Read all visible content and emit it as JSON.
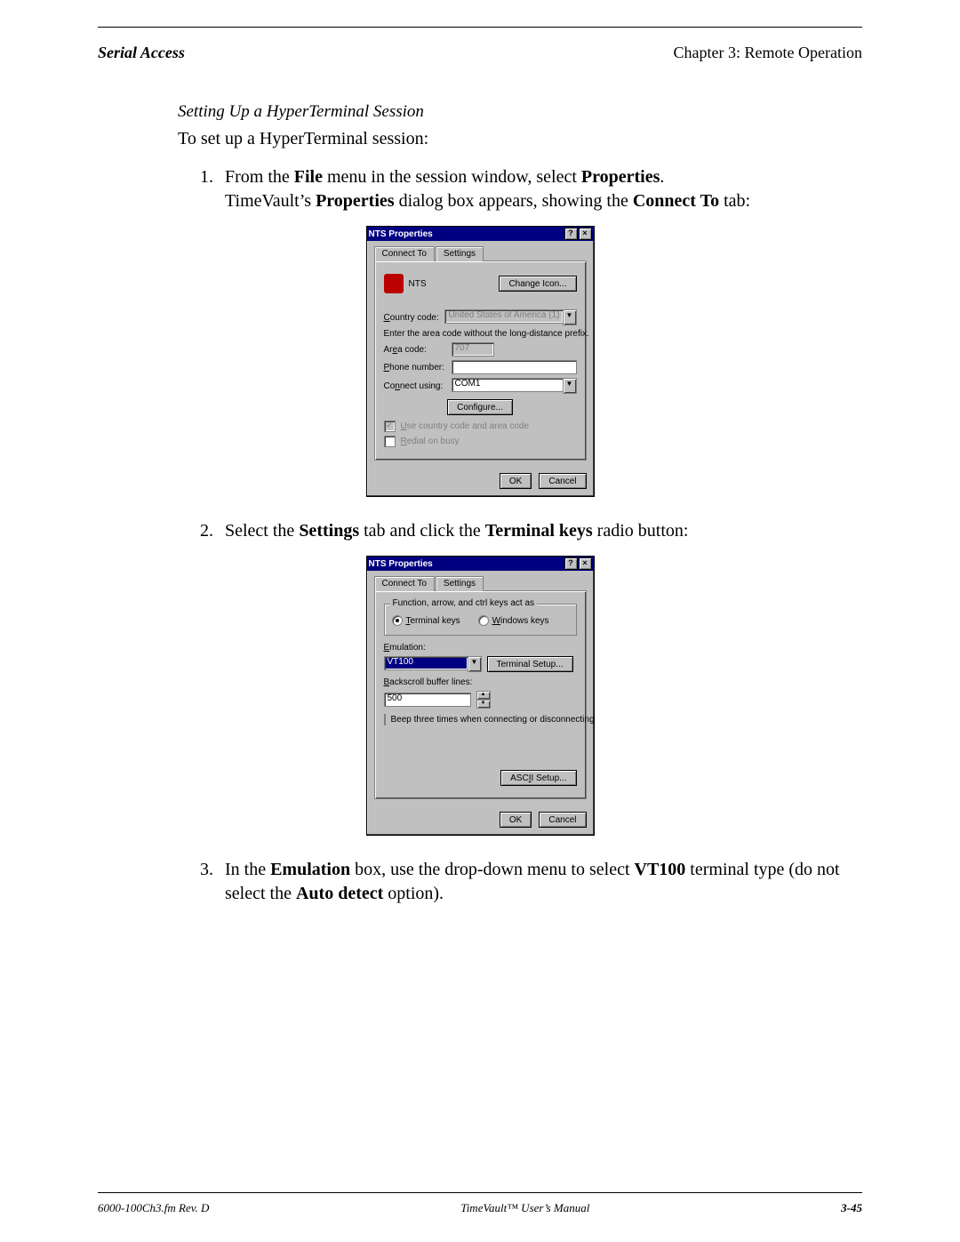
{
  "header": {
    "left": "Serial Access",
    "right": "Chapter 3: Remote Operation"
  },
  "section_title": "Setting Up a HyperTerminal Session",
  "intro": "To set up a HyperTerminal session:",
  "steps": {
    "s1_num": "1.",
    "s1_a": "From the ",
    "s1_b": "File",
    "s1_c": " menu in the session window, select ",
    "s1_d": "Properties",
    "s1_e": ".",
    "s1_f": "TimeVault’s ",
    "s1_g": "Properties",
    "s1_h": " dialog box appears, showing the ",
    "s1_i": "Connect To",
    "s1_j": " tab:",
    "s2_num": "2.",
    "s2_a": "Select the ",
    "s2_b": "Settings",
    "s2_c": " tab and click the ",
    "s2_d": "Terminal keys",
    "s2_e": " radio button:",
    "s3_num": "3.",
    "s3_a": "In the ",
    "s3_b": "Emulation",
    "s3_c": " box, use the drop-down menu to select ",
    "s3_d": "VT100",
    "s3_e": " terminal type (do not select the ",
    "s3_f": "Auto detect",
    "s3_g": " option)."
  },
  "dlg1": {
    "title": "NTS Properties",
    "tab_connect": "Connect To",
    "tab_settings": "Settings",
    "icon_label": "NTS",
    "change_icon": "Change Icon...",
    "country_label": "Country code:",
    "country_value": "United States of America (1)",
    "areacode_hint": "Enter the area code without the long-distance prefix.",
    "areacode_label": "Area code:",
    "areacode_value": "707",
    "phone_label": "Phone number:",
    "phone_value": "",
    "connect_label": "Connect using:",
    "connect_value": "COM1",
    "configure": "Configure...",
    "chk1": "Use country code and area code",
    "chk2": "Redial on busy",
    "ok": "OK",
    "cancel": "Cancel"
  },
  "dlg2": {
    "title": "NTS Properties",
    "tab_connect": "Connect To",
    "tab_settings": "Settings",
    "group_legend": "Function, arrow, and ctrl keys act as",
    "radio_terminal": "Terminal keys",
    "radio_windows": "Windows keys",
    "emulation_label": "Emulation:",
    "emulation_value": "VT100",
    "terminal_setup": "Terminal Setup...",
    "backscroll_label": "Backscroll buffer lines:",
    "backscroll_value": "500",
    "beep": "Beep three times when connecting or disconnecting",
    "ascii_setup": "ASCII Setup...",
    "ok": "OK",
    "cancel": "Cancel"
  },
  "footer": {
    "left": "6000-100Ch3.fm  Rev. D",
    "center": "TimeVault™ User’s Manual",
    "right": "3-45"
  }
}
